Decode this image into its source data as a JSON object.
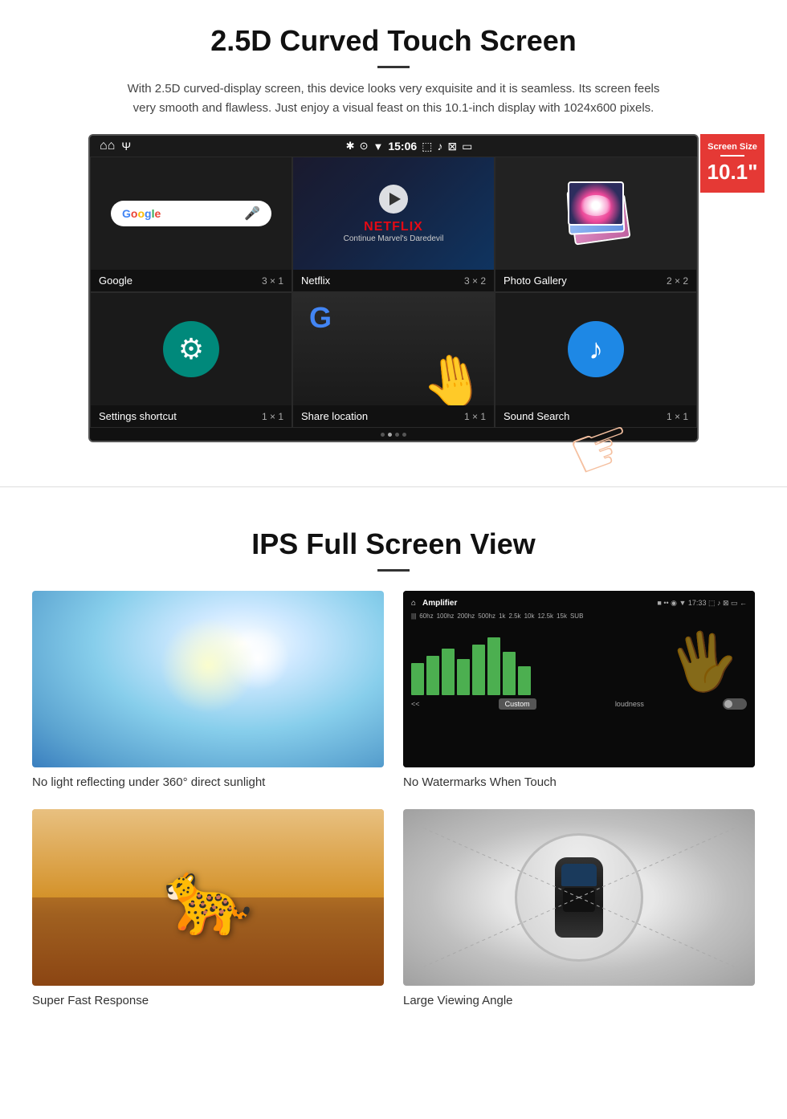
{
  "section1": {
    "title": "2.5D Curved Touch Screen",
    "description": "With 2.5D curved-display screen, this device looks very exquisite and it is seamless. Its screen feels very smooth and flawless. Just enjoy a visual feast on this 10.1-inch display with 1024x600 pixels.",
    "screen_size_badge": {
      "label": "Screen Size",
      "size": "10.1\""
    },
    "status_bar": {
      "time": "15:06"
    },
    "grid_cells": [
      {
        "name": "Google",
        "size": "3 × 1"
      },
      {
        "name": "Netflix",
        "size": "3 × 2"
      },
      {
        "name": "Photo Gallery",
        "size": "2 × 2"
      },
      {
        "name": "Settings shortcut",
        "size": "1 × 1"
      },
      {
        "name": "Share location",
        "size": "1 × 1"
      },
      {
        "name": "Sound Search",
        "size": "1 × 1"
      }
    ],
    "netflix_text": {
      "brand": "NETFLIX",
      "subtitle": "Continue Marvel's Daredevil"
    }
  },
  "section2": {
    "title": "IPS Full Screen View",
    "features": [
      {
        "label": "No light reflecting under 360° direct sunlight"
      },
      {
        "label": "No Watermarks When Touch"
      },
      {
        "label": "Super Fast Response"
      },
      {
        "label": "Large Viewing Angle"
      }
    ]
  }
}
